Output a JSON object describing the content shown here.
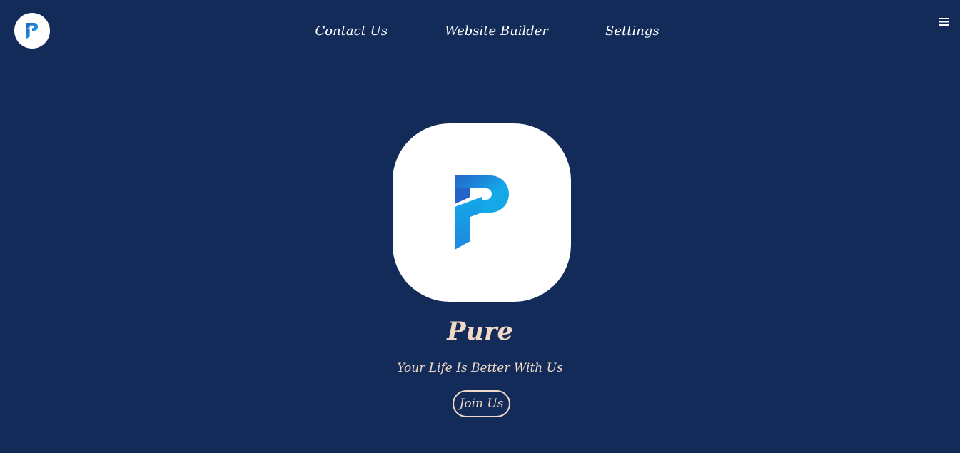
{
  "header": {
    "logo_icon": "pure-p-logo-icon",
    "nav": [
      {
        "label": "Contact Us"
      },
      {
        "label": "Website Builder"
      },
      {
        "label": "Settings"
      }
    ],
    "menu_icon": "hamburger-menu-icon"
  },
  "hero": {
    "logo_icon": "pure-p-logo-icon",
    "title": "Pure",
    "subtitle": "Your Life Is Better With Us",
    "cta_label": "Join Us"
  },
  "colors": {
    "background": "#122b58",
    "nav_text": "#ffffff",
    "accent_text": "#f0d9c7",
    "logo_blue_light": "#14a8e8",
    "logo_blue_dark": "#2563c9"
  }
}
